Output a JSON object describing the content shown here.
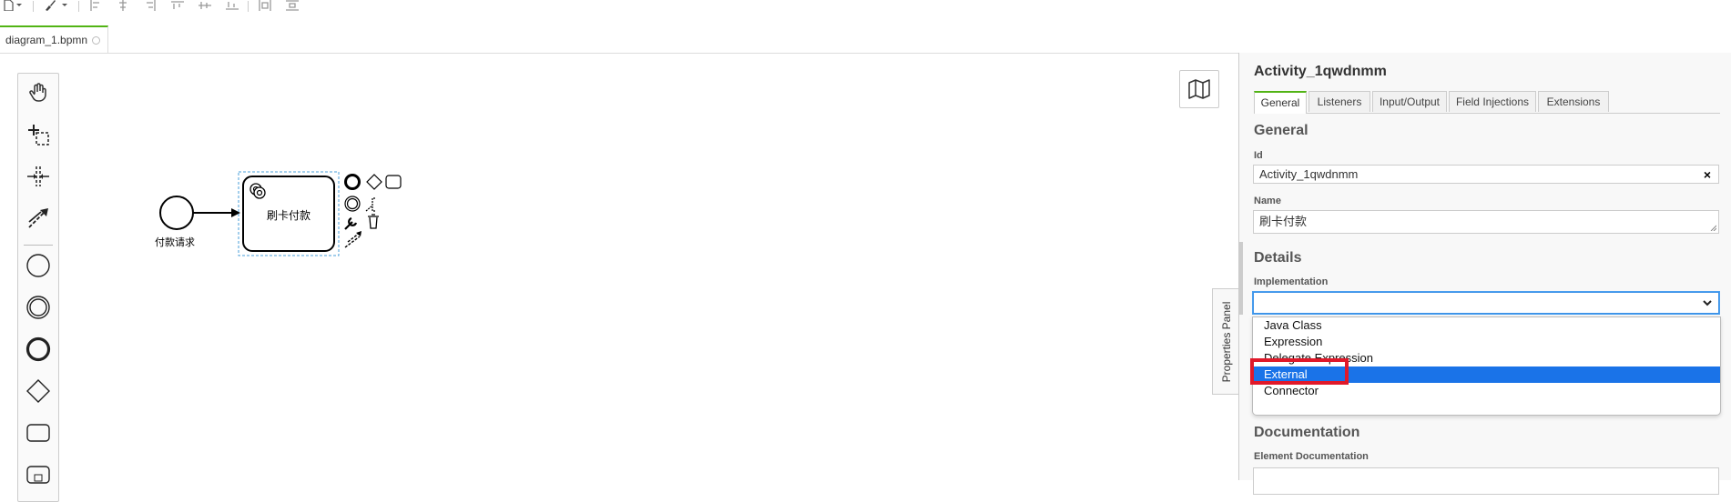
{
  "toolbar": {
    "icons": [
      "file-icon",
      "dropdown-caret-icon",
      "brush-icon",
      "dropdown-caret-icon",
      "align-left-icon",
      "align-center-icon",
      "align-right-icon",
      "align-top-icon",
      "align-middle-icon",
      "align-bottom-icon",
      "distribute-horizontal-icon",
      "distribute-vertical-icon"
    ]
  },
  "tabs": [
    {
      "label": "diagram_1.bpmn"
    }
  ],
  "palette": {
    "tools": [
      "hand-tool-icon",
      "lasso-tool-icon",
      "space-tool-icon",
      "connect-tool-icon",
      "start-event-icon",
      "intermediate-event-icon",
      "end-event-icon",
      "gateway-icon",
      "task-icon",
      "subprocess-icon"
    ]
  },
  "diagram": {
    "start_event_label": "付款请求",
    "task_label": "刷卡付款",
    "task_icon": "gear-icon",
    "context_pad": [
      "end-event-icon",
      "gateway-icon",
      "task-icon",
      "intermediate-event-icon",
      "annotation-icon",
      "wrench-icon",
      "trash-icon",
      "connect-icon"
    ]
  },
  "properties_panel": {
    "toggle_label": "Properties Panel",
    "element_title": "Activity_1qwdnmm",
    "tabs": [
      "General",
      "Listeners",
      "Input/Output",
      "Field Injections",
      "Extensions"
    ],
    "active_tab": "General",
    "general": {
      "heading": "General",
      "id_label": "Id",
      "id_value": "Activity_1qwdnmm",
      "clear_symbol": "×",
      "name_label": "Name",
      "name_value": "刷卡付款"
    },
    "details": {
      "heading": "Details",
      "implementation_label": "Implementation",
      "implementation_value": "",
      "options": [
        "Java Class",
        "Expression",
        "Delegate Expression",
        "External",
        "Connector"
      ],
      "highlighted_option": "External"
    },
    "documentation": {
      "heading": "Documentation",
      "element_documentation_label": "Element Documentation"
    }
  },
  "colors": {
    "accent_green": "#52b415",
    "selection_blue": "#1a73e8",
    "highlight_red": "#e0192a"
  }
}
